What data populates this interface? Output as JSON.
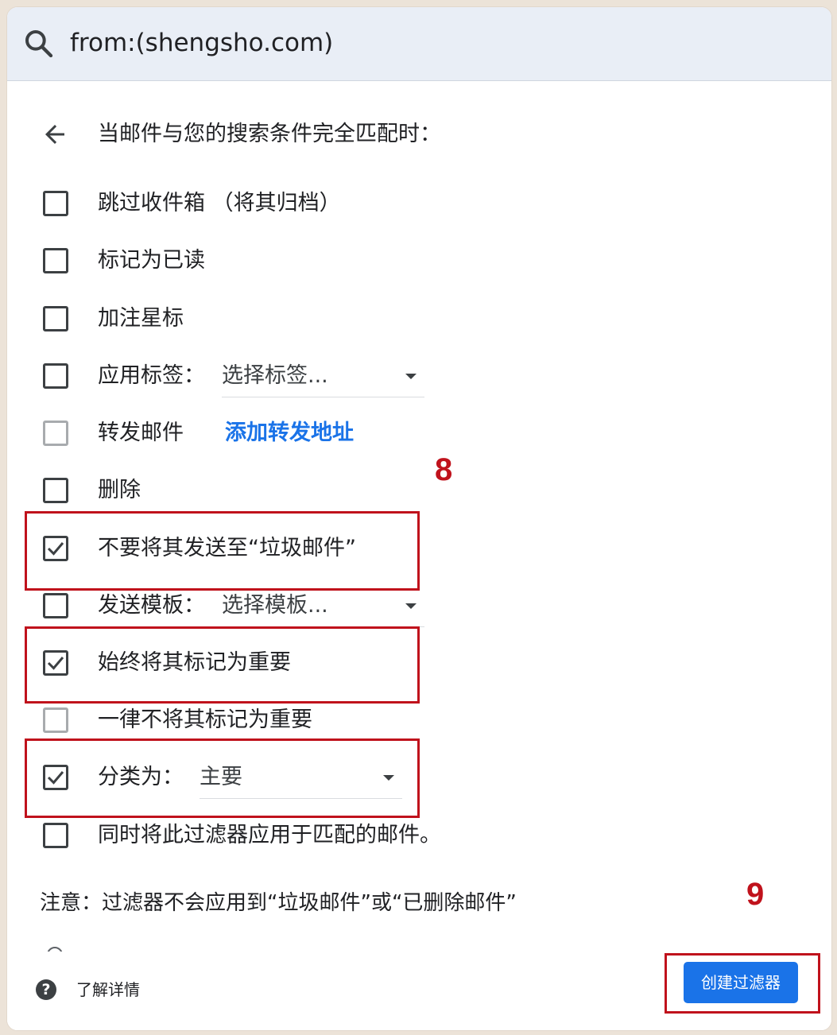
{
  "search": {
    "query": "from:(shengsho.com)"
  },
  "header": {
    "text": "当邮件与您的搜索条件完全匹配时："
  },
  "options": [
    {
      "label": "跳过收件箱 （将其归档）",
      "checked": false,
      "disabled": false
    },
    {
      "label": "标记为已读",
      "checked": false,
      "disabled": false
    },
    {
      "label": "加注星标",
      "checked": false,
      "disabled": false
    },
    {
      "label": "应用标签：",
      "checked": false,
      "disabled": false,
      "dropdown": "选择标签..."
    },
    {
      "label": "转发邮件",
      "checked": false,
      "disabled": true,
      "link": "添加转发地址"
    },
    {
      "label": "删除",
      "checked": false,
      "disabled": false
    },
    {
      "label": "不要将其发送至“垃圾邮件”",
      "checked": true,
      "disabled": false
    },
    {
      "label": "发送模板：",
      "checked": false,
      "disabled": false,
      "dropdown": "选择模板..."
    },
    {
      "label": "始终将其标记为重要",
      "checked": true,
      "disabled": false
    },
    {
      "label": "一律不将其标记为重要",
      "checked": false,
      "disabled": true
    },
    {
      "label": "分类为：",
      "checked": true,
      "disabled": false,
      "dropdown": "主要"
    },
    {
      "label": "同时将此过滤器应用于匹配的邮件。",
      "checked": false,
      "disabled": false
    }
  ],
  "note": "注意：过滤器不会应用到“垃圾邮件”或“已删除邮件”",
  "footer": {
    "learn_more": "了解详情",
    "create_button": "创建过滤器",
    "help_glyph": "?"
  },
  "annotations": {
    "step8": "8",
    "step9": "9"
  },
  "colors": {
    "accent": "#1a73e8",
    "highlight": "#c0121c",
    "searchbar_bg": "#e9eef6"
  }
}
